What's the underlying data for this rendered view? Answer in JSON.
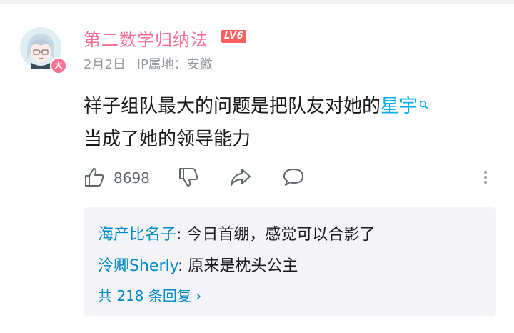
{
  "comment": {
    "username": "第二数学归纳法",
    "level": "LV6",
    "date": "2月2日",
    "ip_location": "IP属地：安徽",
    "avatar_badge": "大",
    "text_before_topic": "祥子组队最大的问题是把队友对她的",
    "topic": "星宇",
    "text_after_topic": "当成了她的领导能力",
    "like_count": "8698"
  },
  "replies": {
    "items": [
      {
        "name": "海产比名子",
        "text": ": 今日首绷，感觉可以合影了"
      },
      {
        "name": "泠卿Sherly",
        "text": ": 原来是枕头公主"
      }
    ],
    "more_label": "共 218 条回复 ›"
  },
  "colors": {
    "username": "#fb7299",
    "topic_link": "#00aeec",
    "reply_name": "#008ac5",
    "meta": "#9499a0",
    "reply_bg": "#f4f4f8"
  },
  "icons": [
    "thumbs-up-icon",
    "thumbs-down-icon",
    "share-icon",
    "reply-bubble-icon",
    "more-vertical-icon",
    "search-icon"
  ]
}
